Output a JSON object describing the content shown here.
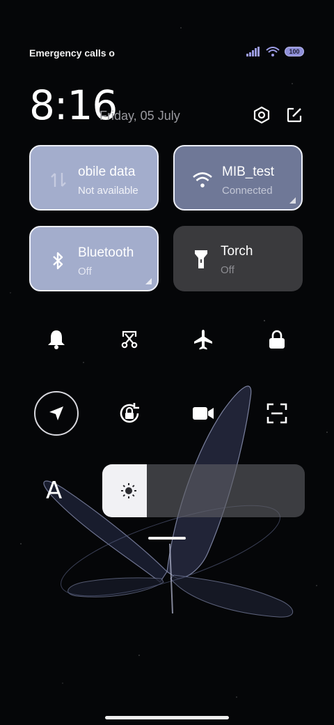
{
  "status_bar": {
    "carrier_text": "Emergency calls o",
    "battery_level": "100",
    "icons": [
      "signal-icon",
      "wifi-icon",
      "battery-icon"
    ]
  },
  "header": {
    "time": "8:16",
    "date": "Friday, 05 July",
    "buttons": [
      "settings-icon",
      "edit-icon"
    ]
  },
  "tiles": {
    "mobile_data": {
      "title": "obile data",
      "status": "Not available",
      "icon": "data-arrows-icon",
      "active": true
    },
    "wifi": {
      "title": "MIB_test",
      "status": "Connected",
      "icon": "wifi-icon",
      "active": true
    },
    "bluetooth": {
      "title": "Bluetooth",
      "status": "Off",
      "icon": "bluetooth-icon",
      "active": true
    },
    "torch": {
      "title": "Torch",
      "status": "Off",
      "icon": "torch-icon",
      "active": false
    }
  },
  "quick_toggles_row1": [
    "bell-icon",
    "screenshot-cut-icon",
    "airplane-icon",
    "lock-icon"
  ],
  "quick_toggles_row2": [
    "location-icon",
    "rotation-lock-icon",
    "video-camera-icon",
    "scan-icon"
  ],
  "font_button_label": "A",
  "brightness": {
    "level": 0.22,
    "icon": "sun-icon"
  },
  "colors": {
    "tile_active": "#a3adcc",
    "tile_wifi": "#6f7897",
    "tile_inactive": "#3a3a3d",
    "text_secondary": "#9a9aa0"
  }
}
